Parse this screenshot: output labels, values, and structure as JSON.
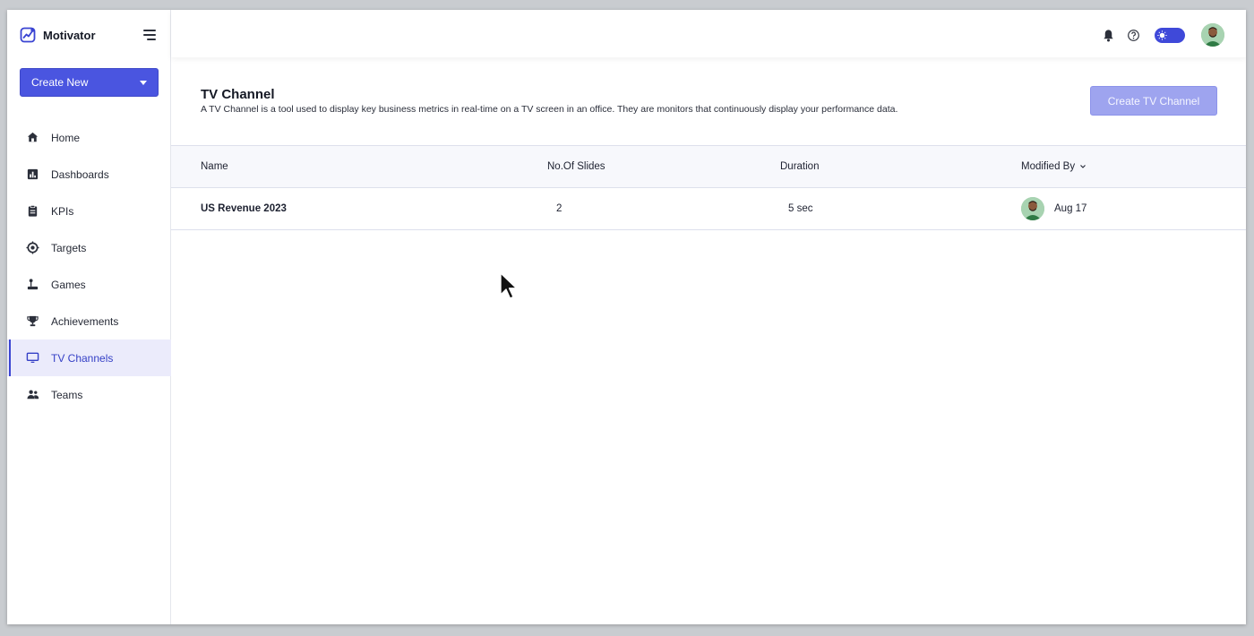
{
  "app": {
    "name": "Motivator"
  },
  "sidebar": {
    "create_new_label": "Create New",
    "items": [
      {
        "label": "Home",
        "icon": "home-icon",
        "active": false
      },
      {
        "label": "Dashboards",
        "icon": "dashboard-icon",
        "active": false
      },
      {
        "label": "KPIs",
        "icon": "clipboard-icon",
        "active": false
      },
      {
        "label": "Targets",
        "icon": "target-icon",
        "active": false
      },
      {
        "label": "Games",
        "icon": "joystick-icon",
        "active": false
      },
      {
        "label": "Achievements",
        "icon": "trophy-icon",
        "active": false
      },
      {
        "label": "TV Channels",
        "icon": "monitor-icon",
        "active": true
      },
      {
        "label": "Teams",
        "icon": "team-icon",
        "active": false
      }
    ]
  },
  "topbar": {
    "icons": [
      "bell-icon",
      "help-icon",
      "theme-toggle-icon",
      "avatar"
    ]
  },
  "page": {
    "title": "TV Channel",
    "description": "A TV Channel is a tool used to display key business metrics in real-time on a TV screen in an office. They are monitors that continuously display your performance data.",
    "create_button": "Create TV Channel"
  },
  "table": {
    "columns": [
      "Name",
      "No.Of Slides",
      "Duration",
      "Modified By"
    ],
    "rows": [
      {
        "name": "US Revenue 2023",
        "slides": "2",
        "duration": "5 sec",
        "modified": "Aug 17"
      }
    ]
  },
  "colors": {
    "accent": "#4a55e0",
    "active_bg": "#ebebfb",
    "disabled_button": "#9ea4ef"
  }
}
